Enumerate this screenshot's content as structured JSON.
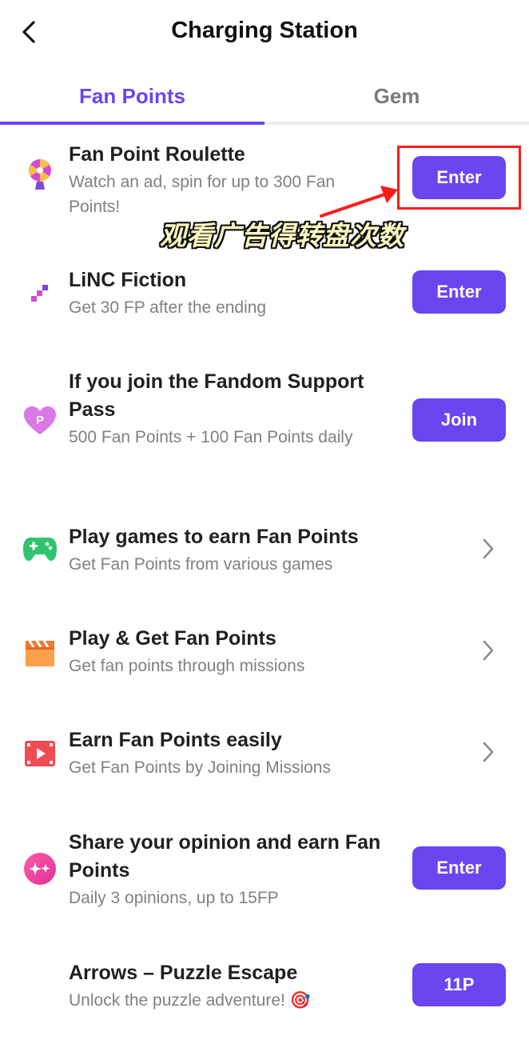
{
  "header": {
    "title": "Charging Station"
  },
  "tabs": [
    {
      "label": "Fan Points",
      "active": true
    },
    {
      "label": "Gem",
      "active": false
    }
  ],
  "items": [
    {
      "icon": "roulette-icon",
      "title": "Fan Point Roulette",
      "subtitle": "Watch an ad, spin for up to 300 Fan Points!",
      "action": "button",
      "action_label": "Enter"
    },
    {
      "icon": "linc-fiction-icon",
      "title": "LiNC Fiction",
      "subtitle": "Get 30 FP after the ending",
      "action": "button",
      "action_label": "Enter"
    },
    {
      "icon": "heart-p-icon",
      "title": "If you join the Fandom Support Pass",
      "subtitle": "500 Fan Points + 100 Fan Points daily",
      "action": "button",
      "action_label": "Join"
    },
    {
      "icon": "gamepad-icon",
      "title": "Play games to earn Fan Points",
      "subtitle": "Get Fan Points from various games",
      "action": "chevron"
    },
    {
      "icon": "clapperboard-icon",
      "title": "Play & Get Fan Points",
      "subtitle": "Get fan points through missions",
      "action": "chevron"
    },
    {
      "icon": "video-play-icon",
      "title": "Earn Fan Points easily",
      "subtitle": "Get Fan Points by Joining Missions",
      "action": "chevron"
    },
    {
      "icon": "sparkle-icon",
      "title": "Share your opinion and earn Fan Points",
      "subtitle": "Daily 3 opinions, up to 15FP",
      "action": "button",
      "action_label": "Enter"
    },
    {
      "icon": "",
      "title": "Arrows – Puzzle Escape",
      "subtitle": "Unlock the puzzle adventure! 🎯",
      "action": "button",
      "action_label": "11P"
    }
  ],
  "annotation": {
    "caption": "观看广告得转盘次数",
    "box_color": "#ff1a1a"
  },
  "colors": {
    "accent": "#6b45f0",
    "title_text": "#1f1f24",
    "subtitle_text": "#7f7f86"
  }
}
